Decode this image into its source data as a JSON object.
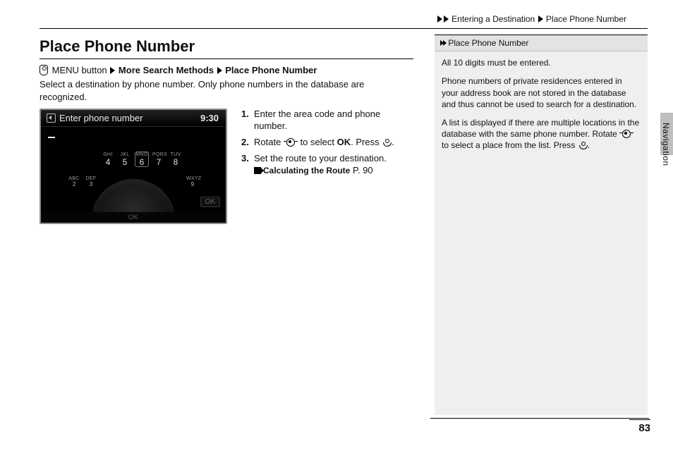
{
  "breadcrumb": {
    "level1": "Entering a Destination",
    "level2": "Place Phone Number"
  },
  "title": "Place Phone Number",
  "path": {
    "prefix": "MENU button",
    "step1": "More Search Methods",
    "step2": "Place Phone Number"
  },
  "intro": "Select a destination by phone number. Only phone numbers in the database are recognized.",
  "device": {
    "prompt": "Enter phone number",
    "clock": "9:30",
    "keys_top_labels": [
      "",
      "",
      "GHI",
      "JKL",
      "MNO",
      "PQRS",
      "TUV",
      ""
    ],
    "keys_top_nums": [
      "",
      "",
      "4",
      "5",
      "6",
      "7",
      "8",
      ""
    ],
    "keys_low_labels": [
      "ABC",
      "DEF",
      "",
      "",
      "",
      "",
      "",
      "WXYZ"
    ],
    "keys_low_nums": [
      "2",
      "3",
      "",
      "",
      "",
      "",
      "",
      "9"
    ],
    "ok_small": "OK",
    "ok_bottom": "OK"
  },
  "steps": {
    "s1": "Enter the area code and phone number.",
    "s2a": "Rotate",
    "s2b": "to select",
    "s2c": "OK",
    "s2d": ". Press",
    "s2e": ".",
    "s3": "Set the route to your destination.",
    "xref": "Calculating the Route",
    "xref_page": "P. 90"
  },
  "sidebox": {
    "heading": "Place Phone Number",
    "p1": "All 10 digits must be entered.",
    "p2": "Phone numbers of private residences entered in your address book are not stored in the database and thus cannot be used to search for a destination.",
    "p3a": "A list is displayed if there are multiple locations in the database with the same phone number. Rotate",
    "p3b": "to select a place from the list. Press",
    "p3c": "."
  },
  "edge_label": "Navigation",
  "page_number": "83"
}
